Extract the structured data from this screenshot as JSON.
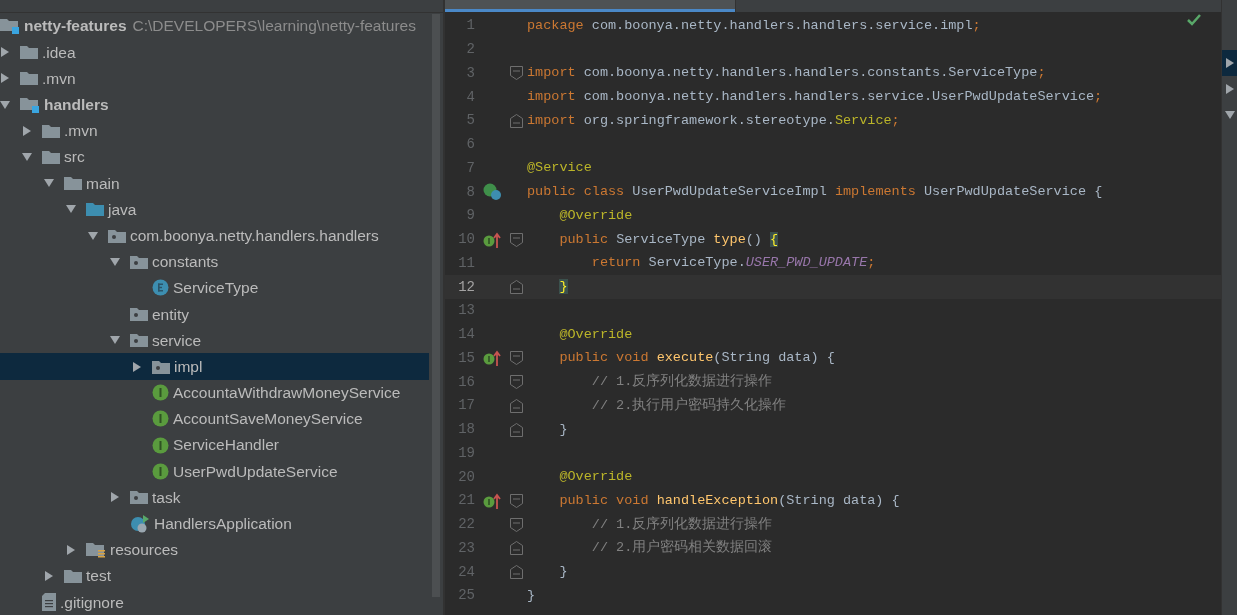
{
  "project_tree": {
    "root": {
      "name": "netty-features",
      "path": "C:\\DEVELOPERS\\learning\\netty-features",
      "kind": "module",
      "selected": false,
      "children": [
        {
          "name": ".idea",
          "kind": "folder",
          "expanded": false,
          "selected": false
        },
        {
          "name": ".mvn",
          "kind": "folder",
          "expanded": false,
          "selected": false
        },
        {
          "name": "handlers",
          "kind": "module",
          "expanded": true,
          "selected": false,
          "children": [
            {
              "name": ".mvn",
              "kind": "folder",
              "expanded": false,
              "selected": false
            },
            {
              "name": "src",
              "kind": "folder",
              "expanded": true,
              "selected": false,
              "children": [
                {
                  "name": "main",
                  "kind": "folder",
                  "expanded": true,
                  "selected": false,
                  "children": [
                    {
                      "name": "java",
                      "kind": "source",
                      "expanded": true,
                      "selected": false,
                      "children": [
                        {
                          "name": "com.boonya.netty.handlers.handlers",
                          "kind": "package",
                          "expanded": true,
                          "selected": false,
                          "children": [
                            {
                              "name": "constants",
                              "kind": "package",
                              "expanded": true,
                              "selected": false,
                              "children": [
                                {
                                  "name": "ServiceType",
                                  "kind": "enum",
                                  "selected": false
                                }
                              ]
                            },
                            {
                              "name": "entity",
                              "kind": "package",
                              "selected": false
                            },
                            {
                              "name": "service",
                              "kind": "package",
                              "expanded": true,
                              "selected": false,
                              "children": [
                                {
                                  "name": "impl",
                                  "kind": "package",
                                  "expanded": false,
                                  "selected": true
                                },
                                {
                                  "name": "AccountaWithdrawMoneyService",
                                  "kind": "interface",
                                  "selected": false
                                },
                                {
                                  "name": "AccountSaveMoneyService",
                                  "kind": "interface",
                                  "selected": false
                                },
                                {
                                  "name": "ServiceHandler",
                                  "kind": "interface",
                                  "selected": false
                                },
                                {
                                  "name": "UserPwdUpdateService",
                                  "kind": "interface",
                                  "selected": false
                                }
                              ]
                            },
                            {
                              "name": "task",
                              "kind": "package",
                              "expanded": false,
                              "selected": false
                            },
                            {
                              "name": "HandlersApplication",
                              "kind": "application",
                              "selected": false
                            }
                          ]
                        }
                      ]
                    },
                    {
                      "name": "resources",
                      "kind": "resources",
                      "expanded": false,
                      "selected": false
                    }
                  ]
                },
                {
                  "name": "test",
                  "kind": "folder",
                  "expanded": false,
                  "selected": false
                }
              ]
            },
            {
              "name": ".gitignore",
              "kind": "file",
              "selected": false
            }
          ]
        }
      ]
    }
  },
  "editor": {
    "lines": [
      {
        "number": "1",
        "current": false,
        "tokens": [
          {
            "text": "package ",
            "kind": "keyword"
          },
          {
            "text": "com.boonya.netty.handlers.handlers.service.impl",
            "kind": "plain"
          },
          {
            "text": ";",
            "kind": "keyword"
          }
        ]
      },
      {
        "number": "2",
        "current": false
      },
      {
        "number": "3",
        "current": false,
        "fold": {
          "kind": "start"
        },
        "tokens": [
          {
            "text": "import ",
            "kind": "keyword"
          },
          {
            "text": "com.boonya.netty.handlers.handlers.constants.ServiceType",
            "kind": "plain"
          },
          {
            "text": ";",
            "kind": "keyword"
          }
        ]
      },
      {
        "number": "4",
        "current": false,
        "tokens": [
          {
            "text": "import ",
            "kind": "keyword"
          },
          {
            "text": "com.boonya.netty.handlers.handlers.service.UserPwdUpdateService",
            "kind": "plain"
          },
          {
            "text": ";",
            "kind": "keyword"
          }
        ]
      },
      {
        "number": "5",
        "current": false,
        "fold": {
          "kind": "end"
        },
        "tokens": [
          {
            "text": "import ",
            "kind": "keyword"
          },
          {
            "text": "org.springframework.stereotype.",
            "kind": "plain"
          },
          {
            "text": "Service",
            "kind": "annotation"
          },
          {
            "text": ";",
            "kind": "keyword"
          }
        ]
      },
      {
        "number": "6",
        "current": false
      },
      {
        "number": "7",
        "current": false,
        "tokens": [
          {
            "text": "@Service",
            "kind": "annotation"
          }
        ]
      },
      {
        "number": "8",
        "current": false,
        "marker": {
          "kind": "implements"
        },
        "tokens": [
          {
            "text": "public class ",
            "kind": "keyword"
          },
          {
            "text": "UserPwdUpdateServiceImpl ",
            "kind": "plain"
          },
          {
            "text": "implements ",
            "kind": "keyword"
          },
          {
            "text": "UserPwdUpdateService {",
            "kind": "plain"
          }
        ]
      },
      {
        "number": "9",
        "current": false,
        "tokens": [
          {
            "text": "    @Override",
            "kind": "annotation"
          }
        ]
      },
      {
        "number": "10",
        "current": false,
        "marker": {
          "kind": "overrides"
        },
        "fold": {
          "kind": "start"
        },
        "tokens": [
          {
            "text": "    public ",
            "kind": "keyword"
          },
          {
            "text": "ServiceType ",
            "kind": "plain"
          },
          {
            "text": "type",
            "kind": "method"
          },
          {
            "text": "() ",
            "kind": "plain"
          },
          {
            "text": "{",
            "kind": "brace_match"
          }
        ]
      },
      {
        "number": "11",
        "current": false,
        "tokens": [
          {
            "text": "        return ",
            "kind": "keyword"
          },
          {
            "text": "ServiceType.",
            "kind": "plain"
          },
          {
            "text": "USER_PWD_UPDATE",
            "kind": "constant"
          },
          {
            "text": ";",
            "kind": "keyword"
          }
        ]
      },
      {
        "number": "12",
        "current": true,
        "fold": {
          "kind": "end"
        },
        "tokens": [
          {
            "text": "    }",
            "kind": "brace_match"
          }
        ]
      },
      {
        "number": "13",
        "current": false
      },
      {
        "number": "14",
        "current": false,
        "tokens": [
          {
            "text": "    @Override",
            "kind": "annotation"
          }
        ]
      },
      {
        "number": "15",
        "current": false,
        "marker": {
          "kind": "overrides"
        },
        "fold": {
          "kind": "start"
        },
        "tokens": [
          {
            "text": "    public void ",
            "kind": "keyword"
          },
          {
            "text": "execute",
            "kind": "method"
          },
          {
            "text": "(String data) {",
            "kind": "plain"
          }
        ]
      },
      {
        "number": "16",
        "current": false,
        "fold": {
          "kind": "start"
        },
        "tokens": [
          {
            "text": "        // 1.反序列化数据进行操作",
            "kind": "comment"
          }
        ]
      },
      {
        "number": "17",
        "current": false,
        "fold": {
          "kind": "end"
        },
        "tokens": [
          {
            "text": "        // 2.执行用户密码持久化操作",
            "kind": "comment"
          }
        ]
      },
      {
        "number": "18",
        "current": false,
        "fold": {
          "kind": "end"
        },
        "tokens": [
          {
            "text": "    }",
            "kind": "plain"
          }
        ]
      },
      {
        "number": "19",
        "current": false
      },
      {
        "number": "20",
        "current": false,
        "tokens": [
          {
            "text": "    @Override",
            "kind": "annotation"
          }
        ]
      },
      {
        "number": "21",
        "current": false,
        "marker": {
          "kind": "overrides"
        },
        "fold": {
          "kind": "start"
        },
        "tokens": [
          {
            "text": "    public void ",
            "kind": "keyword"
          },
          {
            "text": "handleException",
            "kind": "method"
          },
          {
            "text": "(String data) {",
            "kind": "plain"
          }
        ]
      },
      {
        "number": "22",
        "current": false,
        "fold": {
          "kind": "start"
        },
        "tokens": [
          {
            "text": "        // 1.反序列化数据进行操作",
            "kind": "comment"
          }
        ]
      },
      {
        "number": "23",
        "current": false,
        "fold": {
          "kind": "end"
        },
        "tokens": [
          {
            "text": "        // 2.用户密码相关数据回滚",
            "kind": "comment"
          }
        ]
      },
      {
        "number": "24",
        "current": false,
        "fold": {
          "kind": "end"
        },
        "tokens": [
          {
            "text": "    }",
            "kind": "plain"
          }
        ]
      },
      {
        "number": "25",
        "current": false,
        "tokens": [
          {
            "text": "}",
            "kind": "plain"
          }
        ]
      }
    ]
  },
  "side_strip": [
    {
      "kind": "collapsed",
      "selected": true
    },
    {
      "kind": "collapsed",
      "selected": false
    },
    {
      "kind": "expanded",
      "selected": false
    }
  ]
}
